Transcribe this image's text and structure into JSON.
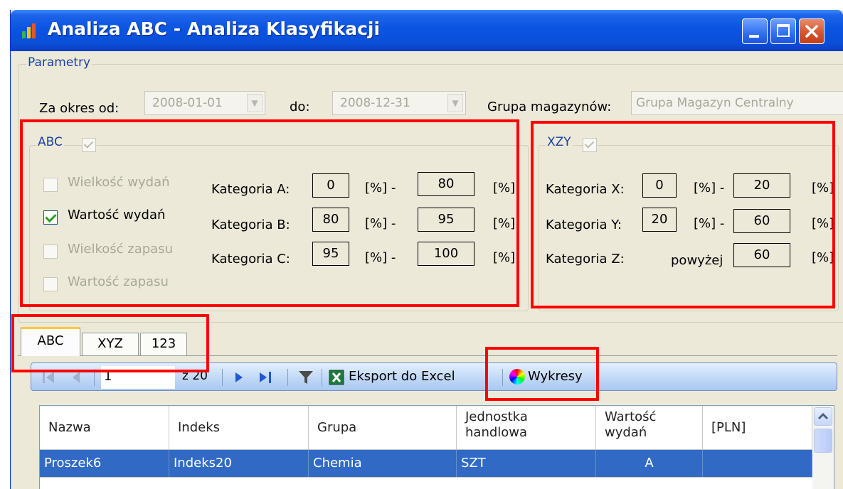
{
  "window": {
    "title": "Analiza ABC - Analiza Klasyfikacji"
  },
  "params": {
    "legend": "Parametry",
    "from_label": "Za okres od:",
    "from_value": "2008-01-01",
    "to_label": "do:",
    "to_value": "2008-12-31",
    "warehouse_label": "Grupa magazynów:",
    "warehouse_value": "Grupa Magazyn Centralny"
  },
  "abc": {
    "legend": "ABC",
    "options": [
      {
        "label": "Wielkość wydań",
        "checked": false,
        "enabled": false
      },
      {
        "label": "Wartość wydań",
        "checked": true,
        "enabled": true
      },
      {
        "label": "Wielkość zapasu",
        "checked": false,
        "enabled": false
      },
      {
        "label": "Wartość zapasu",
        "checked": false,
        "enabled": false
      }
    ],
    "rows": [
      {
        "label": "Kategoria A:",
        "from": "0",
        "to": "80"
      },
      {
        "label": "Kategoria B:",
        "from": "80",
        "to": "95"
      },
      {
        "label": "Kategoria C:",
        "from": "95",
        "to": "100"
      }
    ],
    "pct": "[%]",
    "pct_dash": "[%] -"
  },
  "xzy": {
    "legend": "XZY",
    "rows": [
      {
        "label": "Kategoria X:",
        "from": "0",
        "to": "20"
      },
      {
        "label": "Kategoria Y:",
        "from": "20",
        "to": "60"
      }
    ],
    "z_label": "Kategoria Z:",
    "z_above": "powyżej",
    "z_value": "60",
    "pct": "[%]",
    "pct_dash": "[%] -"
  },
  "tabs": [
    "ABC",
    "XYZ",
    "123"
  ],
  "toolbar": {
    "page": "1",
    "of": "z 20",
    "export_label": "Eksport do Excel",
    "charts_label": "Wykresy"
  },
  "grid": {
    "headers": [
      {
        "line1": "Nazwa",
        "line2": ""
      },
      {
        "line1": "Indeks",
        "line2": ""
      },
      {
        "line1": "Grupa",
        "line2": ""
      },
      {
        "line1": "Jednostka",
        "line2": "handlowa"
      },
      {
        "line1": "Wartość",
        "line2": "wydań"
      },
      {
        "line1": "[PLN]",
        "line2": ""
      }
    ],
    "rows": [
      [
        "Proszek6",
        "Indeks20",
        "Chemia",
        "SZT",
        "A",
        ""
      ]
    ]
  },
  "colors": {
    "title_bar": "#0a54e3",
    "window_bg": "#ECE9D8",
    "highlight": "#ff0000",
    "selection": "#316ac5"
  }
}
